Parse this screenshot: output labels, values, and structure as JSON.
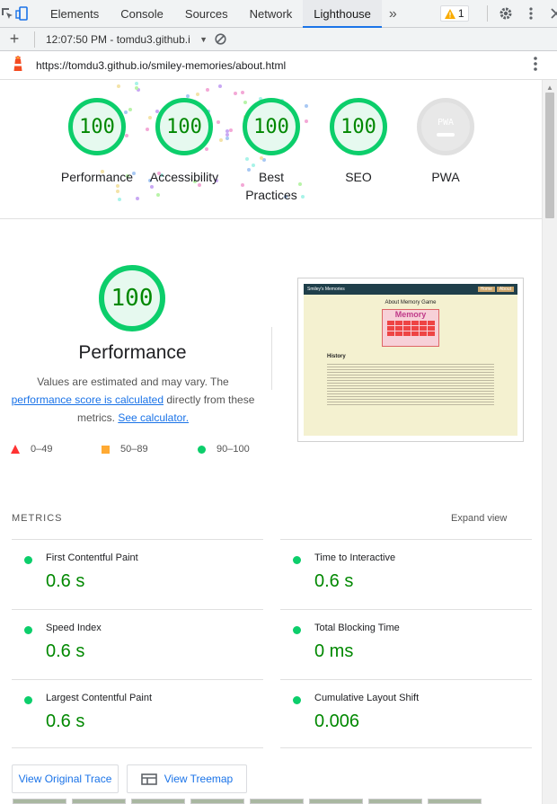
{
  "devtools": {
    "tabs": [
      "Elements",
      "Console",
      "Sources",
      "Network",
      "Lighthouse"
    ],
    "active_tab": "Lighthouse",
    "more_tabs": "»",
    "warnings_count": "1",
    "icons": [
      "inspect-icon",
      "device-toolbar-icon",
      "settings-icon",
      "more-vert-icon",
      "close-icon"
    ]
  },
  "toolbar2": {
    "add_label": "+",
    "report_label": "12:07:50 PM - tomdu3.github.i",
    "clear_icon": "block-icon"
  },
  "urlbar": {
    "url": "https://tomdu3.github.io/smiley-memories/about.html"
  },
  "gauges": [
    {
      "score": "100",
      "label": "Performance"
    },
    {
      "score": "100",
      "label": "Accessibility"
    },
    {
      "score": "100",
      "label": "Best Practices"
    },
    {
      "score": "100",
      "label": "SEO"
    },
    {
      "score": "PWA",
      "label": "PWA"
    }
  ],
  "performance": {
    "score": "100",
    "title": "Performance",
    "desc_prefix": "Values are estimated and may vary. The",
    "desc_link1": "performance score is calculated",
    "desc_mid": "directly from these metrics.",
    "desc_link2": "See calculator.",
    "legend": [
      {
        "range": "0–49",
        "color": "#ff3333"
      },
      {
        "range": "50–89",
        "color": "#ffaa33"
      },
      {
        "range": "90–100",
        "color": "#0cce6b"
      }
    ]
  },
  "screenshot": {
    "nav_title": "Smiley's Memories",
    "nav_buttons": [
      "Home",
      "About"
    ],
    "heading": "About Memory Game",
    "logo_text": "Memory",
    "history_title": "History"
  },
  "metrics": {
    "heading": "METRICS",
    "expand_label": "Expand view",
    "items": [
      {
        "name": "First Contentful Paint",
        "value": "0.6 s"
      },
      {
        "name": "Time to Interactive",
        "value": "0.6 s"
      },
      {
        "name": "Speed Index",
        "value": "0.6 s"
      },
      {
        "name": "Total Blocking Time",
        "value": "0 ms"
      },
      {
        "name": "Largest Contentful Paint",
        "value": "0.6 s"
      },
      {
        "name": "Cumulative Layout Shift",
        "value": "0.006"
      }
    ]
  },
  "buttons": {
    "view_trace": "View Original Trace",
    "view_treemap": "View Treemap"
  },
  "colors": {
    "pass": "#0cce6b",
    "pass_text": "#008800",
    "link": "#1a73e8"
  }
}
